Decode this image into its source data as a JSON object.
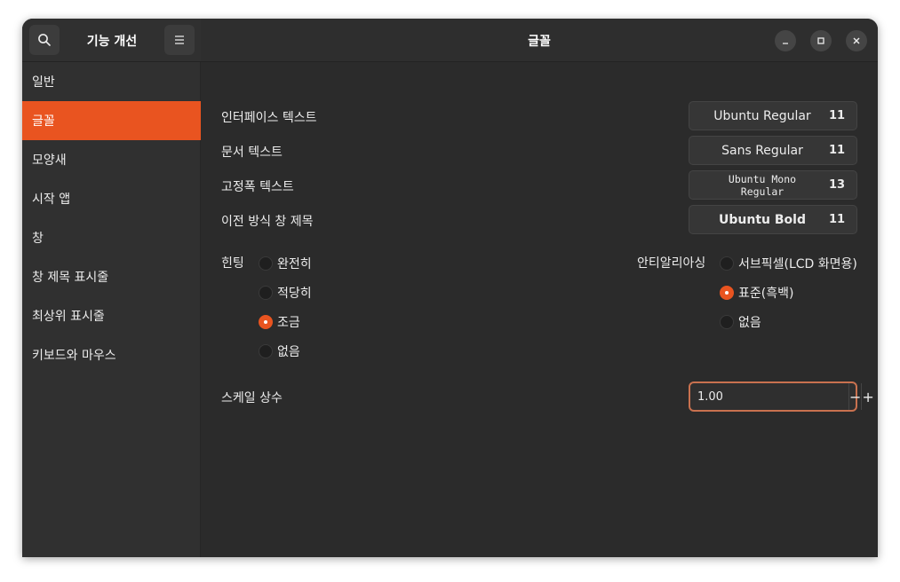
{
  "sidebar": {
    "title": "기능 개선",
    "search_icon": "search-icon",
    "menu_icon": "hamburger-icon",
    "items": [
      {
        "label": "일반"
      },
      {
        "label": "글꼴",
        "active": true
      },
      {
        "label": "모양새"
      },
      {
        "label": "시작 앱"
      },
      {
        "label": "창"
      },
      {
        "label": "창 제목 표시줄"
      },
      {
        "label": "최상위 표시줄"
      },
      {
        "label": "키보드와 마우스"
      }
    ]
  },
  "header": {
    "title": "글꼴",
    "controls": [
      "minimize-icon",
      "maximize-icon",
      "close-icon"
    ]
  },
  "fonts": {
    "interface": {
      "label": "인터페이스 텍스트",
      "font": "Ubuntu Regular",
      "size": "11"
    },
    "document": {
      "label": "문서 텍스트",
      "font": "Sans Regular",
      "size": "11"
    },
    "monospace": {
      "label": "고정폭 텍스트",
      "font": "Ubuntu Mono Regular",
      "size": "13"
    },
    "legacy_title": {
      "label": "이전 방식 창 제목",
      "font": "Ubuntu Bold",
      "size": "11"
    }
  },
  "hinting": {
    "label": "힌팅",
    "options": [
      "완전히",
      "적당히",
      "조금",
      "없음"
    ],
    "selected": "조금"
  },
  "antialiasing": {
    "label": "안티알리아싱",
    "options": [
      "서브픽셀(LCD 화면용)",
      "표준(흑백)",
      "없음"
    ],
    "selected": "표준(흑백)"
  },
  "scale": {
    "label": "스케일 상수",
    "value": "1.00",
    "minus": "−",
    "plus": "+"
  },
  "colors": {
    "accent": "#e95420",
    "window_bg": "#2b2b2b",
    "sidebar_bg": "#303030"
  }
}
